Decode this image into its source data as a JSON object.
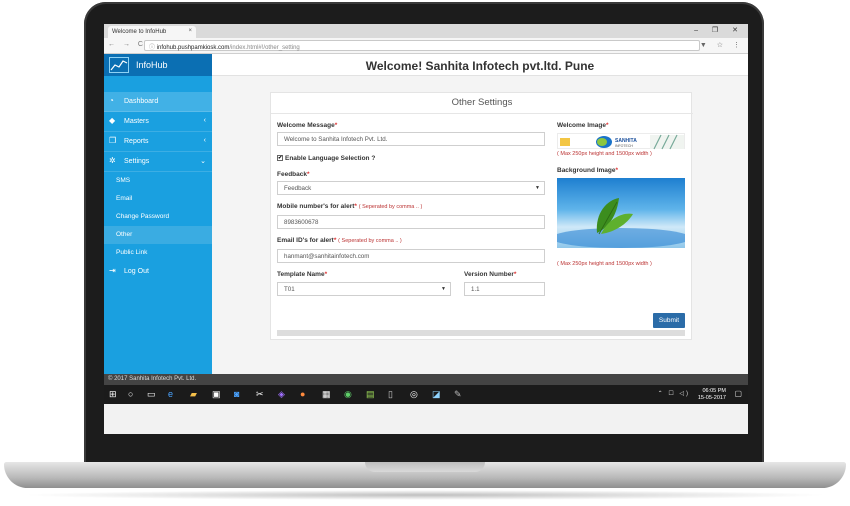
{
  "browser": {
    "tab_title": "Welcome to InfoHub",
    "tab_close": "×",
    "window_controls": "– ❐ ✕",
    "nav": "← → C",
    "url_host": "infohub.pushpamkiosk.com",
    "url_path": "/index.html#!/other_setting",
    "right_icons": "▼ ☆ ⋮"
  },
  "app": {
    "brand": "InfoHub",
    "header_title": "Welcome! Sanhita Infotech pvt.ltd. Pune",
    "accent_color": "#1aa0e0",
    "brand_color": "#0b6fb3"
  },
  "sidebar": {
    "items": [
      {
        "label": "Dashboard",
        "icon": "dashboard-icon"
      },
      {
        "label": "Masters",
        "icon": "diamond-icon"
      },
      {
        "label": "Reports",
        "icon": "copy-icon"
      },
      {
        "label": "Settings",
        "icon": "gear-icon"
      }
    ],
    "submenu": [
      "SMS",
      "Email",
      "Change Password",
      "Other",
      "Public Link"
    ],
    "logout": "Log Out"
  },
  "card": {
    "title": "Other Settings",
    "welcome_message_label": "Welcome Message",
    "welcome_message_value": "Welcome to Sanhita Infotech Pvt. Ltd.",
    "enable_language_label": "Enable Language Selection ?",
    "feedback_label": "Feedback",
    "feedback_value": "Feedback",
    "mobile_label": "Mobile number's for alert",
    "mobile_hint": "( Seperated by comma .. )",
    "mobile_value": "8983600678",
    "email_label": "Email ID's for alert",
    "email_hint": "( Seperated by comma .. )",
    "email_value": "hanmant@sanhitainfotech.com",
    "template_label": "Template Name",
    "template_value": "T01",
    "version_label": "Version Number",
    "version_value": "1.1",
    "welcome_image_label": "Welcome Image",
    "welcome_image_note": "( Max 250px height and 1500px width )",
    "background_image_label": "Background Image",
    "background_image_note": "( Max 250px height and 1500px width )",
    "logo_text": "SANHITA",
    "logo_subtext": "INFOTECH",
    "submit": "Submit"
  },
  "footer": {
    "copyright": "© 2017 Sanhita Infotech Pvt. Ltd."
  },
  "taskbar": {
    "time": "06:05 PM",
    "date": "15-05-2017"
  }
}
